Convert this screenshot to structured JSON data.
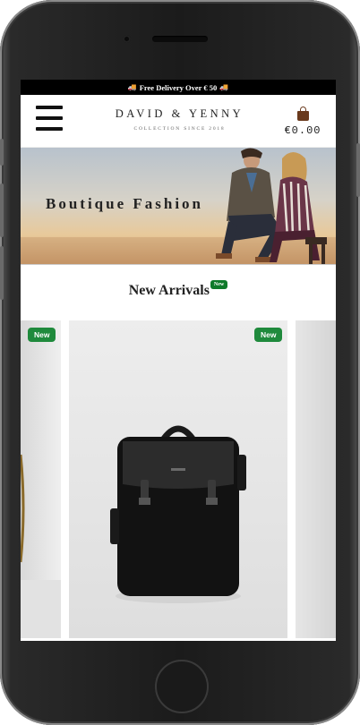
{
  "topbar": {
    "text": "Free Delivery Over € 50"
  },
  "brand": {
    "name": "DAVID & YENNY",
    "subtitle": "COLLECTION SINCE 2018"
  },
  "cart": {
    "total": "€0.00"
  },
  "banner": {
    "title": "Boutique Fashion"
  },
  "section": {
    "title": "New Arrivals",
    "badge": "New"
  },
  "products": [
    {
      "badge": "New"
    },
    {
      "badge": "New"
    },
    {
      "badge": ""
    }
  ],
  "icons": [
    "menu-icon",
    "shopping-bag-icon",
    "truck-icon"
  ]
}
